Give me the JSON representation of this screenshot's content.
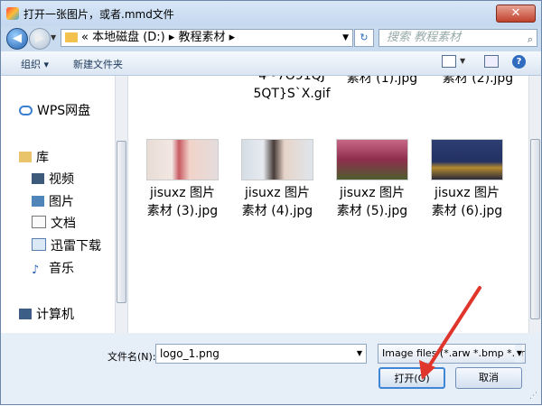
{
  "window": {
    "title": "打开一张图片，或者.mmd文件",
    "close_label": "✕"
  },
  "address": {
    "crumbs": "«  本地磁盘 (D:)  ▸  教程素材  ▸",
    "search_placeholder": "搜索 教程素材"
  },
  "toolbar": {
    "organize": "组织 ▾",
    "new_folder": "新建文件夹",
    "help": "?"
  },
  "nav": {
    "items": [
      {
        "label": "WPS网盘",
        "icon": "cloud-icon"
      },
      {
        "label": "库",
        "icon": "library-icon"
      },
      {
        "label": "视频",
        "icon": "video-icon"
      },
      {
        "label": "图片",
        "icon": "picture-icon"
      },
      {
        "label": "文档",
        "icon": "document-icon"
      },
      {
        "label": "迅雷下载",
        "icon": "download-icon"
      },
      {
        "label": "音乐",
        "icon": "music-icon"
      },
      {
        "label": "计算机",
        "icon": "computer-icon"
      }
    ]
  },
  "files": {
    "top_row": [
      {
        "line1": "4~7O91QJ",
        "line2": "5QT}S`X.gif"
      },
      {
        "line1": "素材 (1).jpg",
        "line2": ""
      },
      {
        "line1": "素材 (2).jpg",
        "line2": ""
      }
    ],
    "items": [
      {
        "line1": "jisuxz 图片",
        "line2": "素材 (3).jpg",
        "color": "#d9c6c0"
      },
      {
        "line1": "jisuxz 图片",
        "line2": "素材 (4).jpg",
        "color": "#cfd6de"
      },
      {
        "line1": "jisuxz 图片",
        "line2": "素材 (5).jpg",
        "color": "#9b3e5c"
      },
      {
        "line1": "jisuxz 图片",
        "line2": "素材 (6).jpg",
        "color": "#2b3a6a"
      }
    ]
  },
  "bottom": {
    "filename_label": "文件名(N):",
    "filename_value": "logo_1.png",
    "filetype_value": "Image files (*.arw *.bmp *.cr",
    "open_label": "打开(O)",
    "cancel_label": "取消"
  }
}
